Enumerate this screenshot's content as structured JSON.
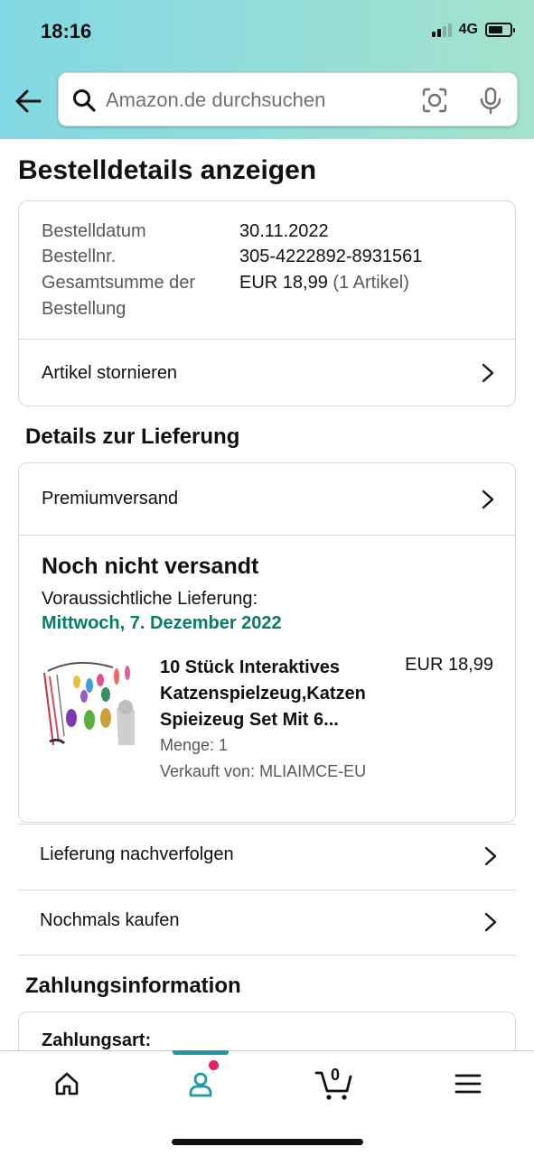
{
  "status_bar": {
    "time": "18:16",
    "network": "4G",
    "battery_level": 0.7
  },
  "search": {
    "placeholder": "Amazon.de durchsuchen"
  },
  "page_title": "Bestelldetails anzeigen",
  "order_summary": {
    "rows": [
      {
        "label": "Bestelldatum",
        "value": "30.11.2022"
      },
      {
        "label": "Bestellnr.",
        "value": "305-4222892-8931561"
      },
      {
        "label": "Gesamtsumme der Bestellung",
        "value": "EUR 18,99",
        "extra": "(1 Artikel)"
      }
    ],
    "cancel_label": "Artikel stornieren"
  },
  "delivery": {
    "section_title": "Details zur Lieferung",
    "shipping_method": "Premiumversand",
    "status": "Noch nicht versandt",
    "estimate_label": "Voraussichtliche Lieferung:",
    "estimate_date": "Mittwoch, 7. Dezember 2022",
    "estimate_color": "#067d62",
    "product": {
      "title": "10 Stück Interaktives Katzenspielzeug,Katzen Spieizeug Set Mit 6...",
      "price": "EUR 18,99",
      "quantity": "Menge: 1",
      "seller": "Verkauft von: MLIAIMCE-EU"
    }
  },
  "actions": {
    "track_label": "Lieferung nachverfolgen",
    "buy_again_label": "Nochmals kaufen"
  },
  "payment": {
    "section_title": "Zahlungsinformation",
    "method_label": "Zahlungsart:"
  },
  "bottom_nav": {
    "cart_count": "0",
    "accent": "#1e9aa4",
    "notification_color": "#e0265d",
    "items": [
      "home-icon",
      "account-icon",
      "cart-icon",
      "menu-icon"
    ]
  }
}
